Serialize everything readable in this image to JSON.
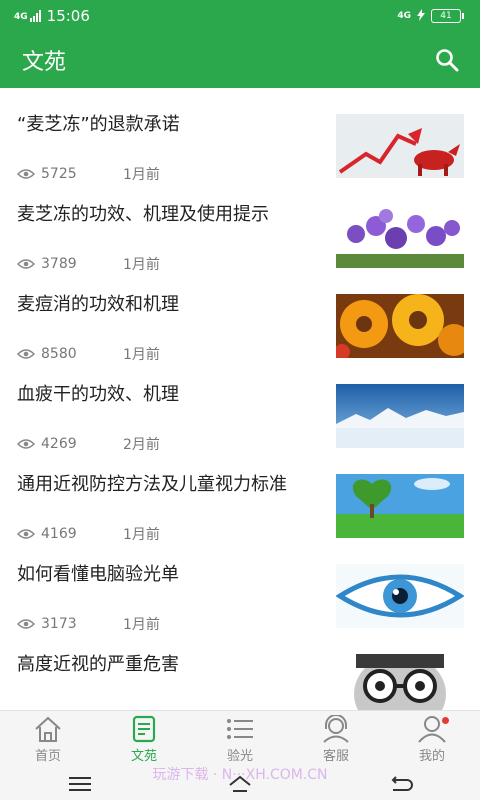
{
  "status": {
    "time": "15:06",
    "left_network": "4G",
    "right_network": "4G",
    "battery": "41"
  },
  "app": {
    "title": "文苑"
  },
  "articles": [
    {
      "title": "“麦芝冻”的退款承诺",
      "views": "5725",
      "time": "1月前",
      "thumb": "stock-arrow-bull"
    },
    {
      "title": "麦芝冻的功效、机理及使用提示",
      "views": "3789",
      "time": "1月前",
      "thumb": "purple-flowers"
    },
    {
      "title": "麦痘消的功效和机理",
      "views": "8580",
      "time": "1月前",
      "thumb": "orange-flowers"
    },
    {
      "title": "血疲干的功效、机理",
      "views": "4269",
      "time": "2月前",
      "thumb": "snow-mountains"
    },
    {
      "title": "通用近视防控方法及儿童视力标准",
      "views": "4169",
      "time": "1月前",
      "thumb": "heart-tree"
    },
    {
      "title": "如何看懂电脑验光单",
      "views": "3173",
      "time": "1月前",
      "thumb": "blue-eye"
    },
    {
      "title": "高度近视的严重危害",
      "views": "",
      "time": "",
      "thumb": "thick-glasses"
    }
  ],
  "tabs": [
    {
      "label": "首页",
      "icon": "home-icon",
      "active": false
    },
    {
      "label": "文苑",
      "icon": "article-icon",
      "active": true
    },
    {
      "label": "验光",
      "icon": "list-icon",
      "active": false
    },
    {
      "label": "客服",
      "icon": "headset-icon",
      "active": false
    },
    {
      "label": "我的",
      "icon": "user-icon",
      "active": false
    }
  ],
  "watermark": "玩游下载 · N···XH.COM.CN",
  "colors": {
    "primary": "#2aa84b",
    "badge": "#e53935"
  }
}
